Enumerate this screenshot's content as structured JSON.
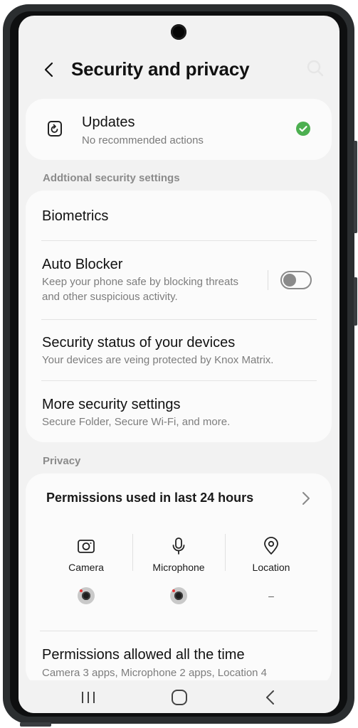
{
  "header": {
    "title": "Security and privacy"
  },
  "updates": {
    "title": "Updates",
    "subtitle": "No recommended actions",
    "status_color": "#4caf50"
  },
  "security_section": {
    "label": "Addtional security settings",
    "items": [
      {
        "title": "Biometrics"
      },
      {
        "title": "Auto Blocker",
        "subtitle": "Keep your phone safe by blocking threats and other suspicious activity.",
        "toggle_on": false
      },
      {
        "title": "Security status of your devices",
        "subtitle": "Your devices are veing protected by Knox Matrix."
      },
      {
        "title": "More security settings",
        "subtitle": "Secure Folder, Secure Wi-Fi, and more."
      }
    ]
  },
  "privacy_section": {
    "label": "Privacy",
    "permissions_title": "Permissions used in last 24 hours",
    "permissions": [
      {
        "label": "Camera",
        "icon": "camera-icon",
        "apps": "app-icon"
      },
      {
        "label": "Microphone",
        "icon": "microphone-icon",
        "apps": "app-icon"
      },
      {
        "label": "Location",
        "icon": "location-icon",
        "apps": "–"
      }
    ],
    "allowed_title": "Permissions allowed all the time",
    "allowed_subtitle": "Camera 3 apps, Microphone 2 apps, Location 4"
  },
  "navbar": {
    "buttons": [
      "recent-apps-icon",
      "home-icon",
      "back-icon"
    ]
  }
}
